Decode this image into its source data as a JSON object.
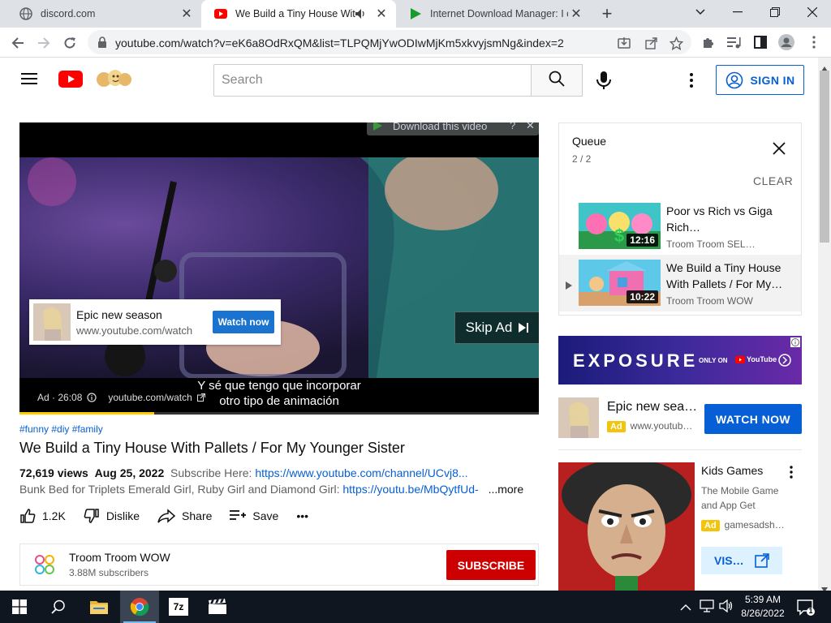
{
  "browser": {
    "tabs": [
      {
        "title": "discord.com",
        "active": false
      },
      {
        "title": "We Build a Tiny House With",
        "active": true
      },
      {
        "title": "Internet Download Manager: I ca",
        "active": false
      }
    ],
    "new_tab_label": "+",
    "url": "youtube.com/watch?v=eK6a8OdRxQM&list=TLPQMjYwODIwMjKm5xkvyjsmNg&index=2"
  },
  "youtube": {
    "search_placeholder": "Search",
    "sign_in_label": "SIGN IN"
  },
  "player": {
    "download_bar_label": "Download this video",
    "download_help": "?",
    "download_close": "✕",
    "ad_card": {
      "title": "Epic new season",
      "url": "www.youtube.com/watch",
      "cta": "Watch now"
    },
    "skip_ad_label": "Skip Ad",
    "caption_line1": "Y sé que tengo que incorporar",
    "caption_line2": "otro tipo de animación",
    "ad_time": "Ad · 26:08",
    "ad_url": "youtube.com/watch",
    "progress": 0.26
  },
  "video": {
    "hashtags": [
      "#funny",
      "#diy",
      "#family"
    ],
    "title": "We Build a Tiny House With Pallets / For My Younger Sister",
    "views": "72,619 views",
    "date": "Aug 25, 2022",
    "subscribe_here": "Subscribe Here:",
    "subscribe_link": "https://www.youtube.com/channel/UCvj8...",
    "desc_text": "Bunk Bed for Triplets Emerald Girl, Ruby Girl and Diamond Girl:",
    "desc_link": "https://youtu.be/MbQytfUd-",
    "more_label": "...more",
    "likes": "1.2K",
    "dislike_label": "Dislike",
    "share_label": "Share",
    "save_label": "Save",
    "more_actions": "•••"
  },
  "channel": {
    "name": "Troom Troom WOW",
    "subscribers": "3.88M subscribers",
    "subscribe_label": "SUBSCRIBE"
  },
  "queue": {
    "title": "Queue",
    "position": "2 / 2",
    "clear_label": "CLEAR",
    "items": [
      {
        "title": "Poor vs Rich vs Giga Rich…",
        "channel": "Troom Troom SEL…",
        "duration": "12:16"
      },
      {
        "title": "We Build a Tiny House With Pallets / For My…",
        "channel": "Troom Troom WOW",
        "duration": "10:22"
      }
    ]
  },
  "sidebar_ads": {
    "banner_text": "EXPOSURE",
    "banner_sub": "ONLY ON",
    "banner_brand": "YouTube",
    "ad1_title": "Epic new sea…",
    "ad1_badge": "Ad",
    "ad1_url": "www.youtub…",
    "ad1_cta": "WATCH NOW",
    "ad2_title": "Kids Games",
    "ad2_desc": "The Mobile Game and App Get",
    "ad2_badge": "Ad",
    "ad2_url": "gamesadsh…",
    "ad2_cta": "VIS…"
  },
  "taskbar": {
    "time": "5:39 AM",
    "date": "8/26/2022",
    "notification_count": "1",
    "app_7z_label": "7z"
  },
  "colors": {
    "youtube_red": "#ff0000",
    "link_blue": "#065fd4",
    "subscribe_red": "#cc0000",
    "ad_badge": "#f2c40c",
    "progress": "#ffcc00"
  }
}
